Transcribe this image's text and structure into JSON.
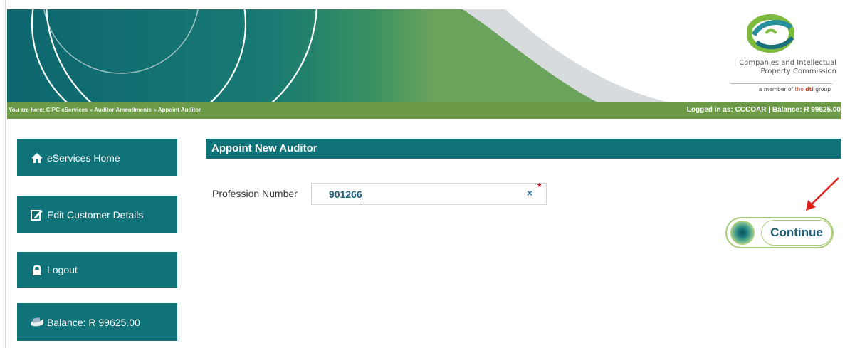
{
  "header": {
    "logo_line1": "Companies and Intellectual",
    "logo_line2": "Property Commission",
    "logo_member_prefix": "a member of ",
    "logo_member_the": "the ",
    "logo_member_dti": "dti",
    "logo_member_suffix": " group"
  },
  "breadcrumb": {
    "prefix": "You are here: ",
    "trail": "CIPC eServices » Auditor Amendments » Appoint Auditor",
    "login_status": "Logged in as: CCCOAR | Balance: R 99625.00"
  },
  "sidebar": {
    "items": [
      {
        "label": "eServices Home",
        "icon": "home-icon"
      },
      {
        "label": "Edit Customer Details",
        "icon": "edit-icon"
      },
      {
        "label": "Logout",
        "icon": "lock-icon"
      },
      {
        "label": "Balance: R 99625.00",
        "icon": "money-icon"
      }
    ]
  },
  "form": {
    "title": "Appoint New Auditor",
    "profession_label": "Profession Number",
    "profession_value": "901266",
    "clear_symbol": "×",
    "required_marker": "*",
    "continue_label": "Continue"
  },
  "colors": {
    "teal": "#0f7379",
    "green_bar": "#6c9a46",
    "accent_green": "#a9cc7a",
    "annotation_arrow": "#e0201b"
  }
}
